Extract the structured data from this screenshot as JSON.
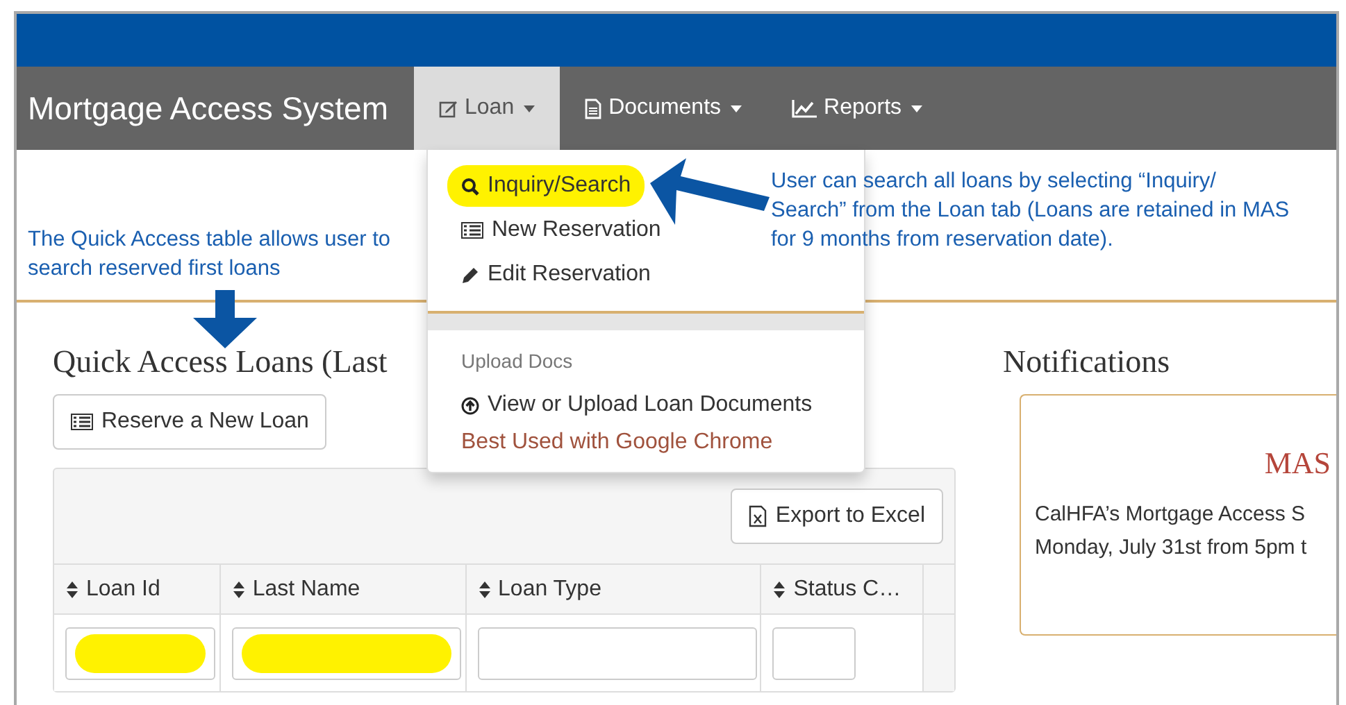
{
  "app_title": "Mortgage Access System",
  "nav": [
    {
      "label": "Loan",
      "selected": true
    },
    {
      "label": "Documents",
      "selected": false
    },
    {
      "label": "Reports",
      "selected": false
    }
  ],
  "loan_menu": {
    "items": [
      {
        "label": "Inquiry/Search",
        "highlighted": true
      },
      {
        "label": "New Reservation",
        "highlighted": false
      },
      {
        "label": "Edit Reservation",
        "highlighted": false
      }
    ],
    "section_header": "Upload Docs",
    "section_item": "View or Upload Loan Documents",
    "note": "Best Used with Google Chrome"
  },
  "quick_access": {
    "title": "Quick Access Loans (Last",
    "reserve_button": "Reserve a New Loan",
    "export_button": "Export to Excel",
    "columns": [
      "Loan Id",
      "Last Name",
      "Loan Type",
      "Status C…"
    ],
    "filters": [
      {
        "highlighted": true
      },
      {
        "highlighted": true
      },
      {
        "highlighted": false
      },
      {
        "highlighted": false
      }
    ]
  },
  "notifications": {
    "title": "Notifications",
    "card_title": "MAS",
    "lines": [
      "CalHFA’s Mortgage Access S",
      "Monday, July 31st from 5pm t"
    ]
  },
  "annotations": [
    {
      "kind": "down_arrow",
      "text": "The Quick Access table allows user to search reserved first loans"
    },
    {
      "kind": "left_arrow",
      "text": "User can search all loans by selecting “Inquiry/ Search” from the Loan tab (Loans are retained in MAS for 9 months from reservation date)."
    }
  ]
}
